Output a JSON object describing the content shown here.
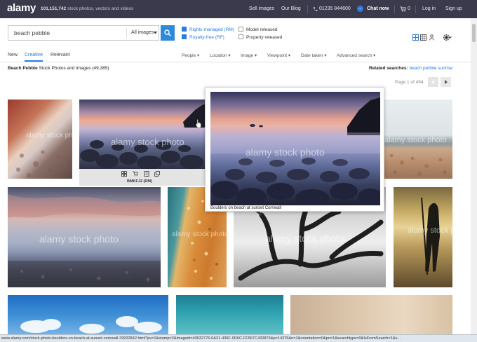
{
  "header": {
    "logo": "alamy",
    "tagline_count": "101,151,742",
    "tagline_text": "stock photos, vectors and videos",
    "sell_images": "Sell images",
    "our_blog": "Our Blog",
    "phone": "01235 844600",
    "chat_now": "Chat now",
    "cart_count": "0",
    "log_in": "Log in",
    "sign_up": "Sign up"
  },
  "search": {
    "query": "beach pebble",
    "category": "All images",
    "rights_managed": "Rights-managed (RM)",
    "royalty_free": "Royalty-free (RF)",
    "model_released": "Model released",
    "property_released": "Property released"
  },
  "tabs": [
    "New",
    "Creative",
    "Relevant"
  ],
  "filters": [
    "People",
    "Location",
    "Image",
    "Viewpoint",
    "Date taken",
    "Advanced search"
  ],
  "results": {
    "heading_bold": "Beach Pebble",
    "heading_rest": "Stock Photos and Images (49,385)",
    "related_label": "Related searches:",
    "related_link": "beach pebble sunrise",
    "page_info": "Page 1 of 494"
  },
  "watermark": "alamy stock photo",
  "hover_image": {
    "code": "BMKFJ2",
    "license": "(RM)"
  },
  "preview": {
    "caption": "Boulders on beach at sunset Cornwall"
  },
  "statusbar": "www.alamy.com/stock-photo-boulders-on-beach-at-sunset-cornwall-29932842.html?pv=1&stamp=2&imageid=40632776-6A31-436F-9D6C-FF567C432876&p=14375&n=1&orientation=0&pn=1&searchtype=0&IsFromSearch=1&s...",
  "colors": {
    "topbar": "#3a3a4c",
    "accent": "#2b7be0",
    "search_button": "#2d8ad8"
  },
  "icons": [
    "search-icon",
    "chat-icon",
    "cart-icon",
    "grid-view-icon",
    "list-view-icon",
    "settings-icon",
    "cursor-icon"
  ]
}
